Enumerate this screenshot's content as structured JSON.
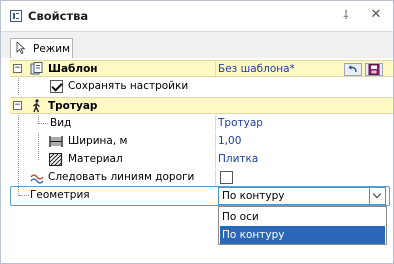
{
  "window": {
    "title": "Свойства"
  },
  "toolbar": {
    "tab_label": "Режим"
  },
  "categories": {
    "template": {
      "label": "Шаблон",
      "value": "Без шаблона*",
      "save_settings": "Сохранять настройки"
    },
    "sidewalk": {
      "label": "Тротуар"
    }
  },
  "properties": {
    "view": {
      "label": "Вид",
      "value": "Тротуар"
    },
    "width": {
      "label": "Ширина, м",
      "value": "1,00"
    },
    "material": {
      "label": "Материал",
      "value": "Плитка"
    },
    "follow": {
      "label": "Следовать линиям дороги"
    },
    "geometry": {
      "label": "Геометрия",
      "value": "По контуру"
    }
  },
  "dropdown": {
    "options": [
      "По оси",
      "По контуру"
    ],
    "selected": "По контуру"
  },
  "colors": {
    "category_bg": "#fff9c4",
    "value_text": "#1e3da6",
    "selection": "#2b67b8",
    "focus": "#5aa0d8"
  }
}
